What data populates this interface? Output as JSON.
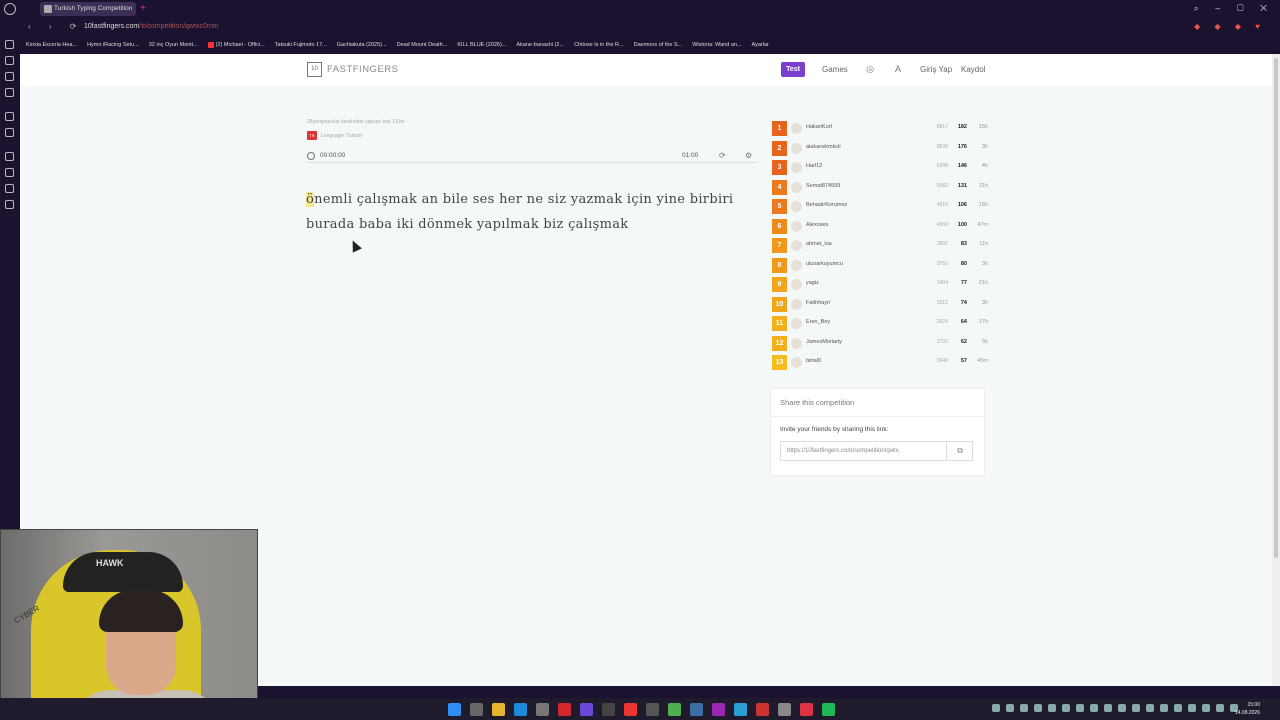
{
  "browser": {
    "tab_title": "Turkish Typing Competition",
    "url_host": "10fastfingers.com",
    "url_path": "/tr/competition/qwtxc0mm",
    "bookmarks": [
      "Kioxia Exceria Hea...",
      "Hymo iRacing Setu...",
      "32 inç Oyun Monit...",
      "(2) Michael - Offici...",
      "Tatsuki Fujimoto 17...",
      "Gachiakuta (2025)...",
      "Dead Mount Death...",
      "KILL BLUE (2026)...",
      "Akane-banashi (2...",
      "Chitose Is in the R...",
      "Daemons of the S...",
      "Wistoria: Wand an...",
      "Ayarlar"
    ]
  },
  "site": {
    "brand_box": "10",
    "brand_name": "FASTFINGERS",
    "nav_test": "Test",
    "nav_games": "Games",
    "nav_login": "Giriş Yap",
    "nav_register": "Kaydol"
  },
  "competition": {
    "subtitle": "28yarışmacılar tarafından yapılan test 13 ler",
    "flag": "TR",
    "language": "Language: Turkish",
    "elapsed": "00:00:00",
    "remaining": "01:00"
  },
  "typing": {
    "current_letter": "ö",
    "rest_of_text": "nemli çalışmak an bile ses her ne siz yazmak için yine birbiri burada baba iki dönmek yapılmak biz çalışmak"
  },
  "leaderboard": [
    {
      "rank": "1",
      "name": "HakanKurt",
      "score": "8817",
      "wpm": "182",
      "time": "15h",
      "color": "#e8641c"
    },
    {
      "rank": "2",
      "name": "alakanekmkcii",
      "score": "8536",
      "wpm": "176",
      "time": "3h",
      "color": "#e8641c"
    },
    {
      "rank": "3",
      "name": "Harl12",
      "score": "6998",
      "wpm": "146",
      "time": "4h",
      "color": "#e8641c"
    },
    {
      "rank": "4",
      "name": "Semat874599",
      "score": "6082",
      "wpm": "131",
      "time": "21h",
      "color": "#ec7a1c"
    },
    {
      "rank": "5",
      "name": "BehadırKorumez",
      "score": "4910",
      "wpm": "106",
      "time": "16h",
      "color": "#ec7a1c"
    },
    {
      "rank": "6",
      "name": "Alexoses",
      "score": "4559",
      "wpm": "100",
      "time": "47m",
      "color": "#ee8a1a"
    },
    {
      "rank": "7",
      "name": "ahmet_lua",
      "score": "3601",
      "wpm": "83",
      "time": "11h",
      "color": "#f0981a"
    },
    {
      "rank": "8",
      "name": "ulusarkuyumcu",
      "score": "3751",
      "wpm": "80",
      "time": "3h",
      "color": "#f0981a"
    },
    {
      "rank": "9",
      "name": "yagiz",
      "score": "3494",
      "wpm": "77",
      "time": "21h",
      "color": "#f2a41a"
    },
    {
      "rank": "10",
      "name": "Fatihhayri",
      "score": "3312",
      "wpm": "74",
      "time": "3h",
      "color": "#f2a41a"
    },
    {
      "rank": "11",
      "name": "Eren_Bey",
      "score": "2624",
      "wpm": "64",
      "time": "17h",
      "color": "#f4b01a"
    },
    {
      "rank": "12",
      "name": "JamesMoriarty",
      "score": "2737",
      "wpm": "62",
      "time": "5h",
      "color": "#f4b01a"
    },
    {
      "rank": "13",
      "name": "birtal0",
      "score": "2640",
      "wpm": "57",
      "time": "40m",
      "color": "#f6bc1a"
    }
  ],
  "share": {
    "title": "Share this competition",
    "label": "Invite your friends by sharing this link:",
    "link": "https://10fastfingers.com/competition/qwtx"
  },
  "webcam": {
    "chair_brand": "HAWK",
    "chair_side": "CYBER"
  },
  "taskbar": {
    "time": "15:00",
    "date": "14.08.2026"
  }
}
